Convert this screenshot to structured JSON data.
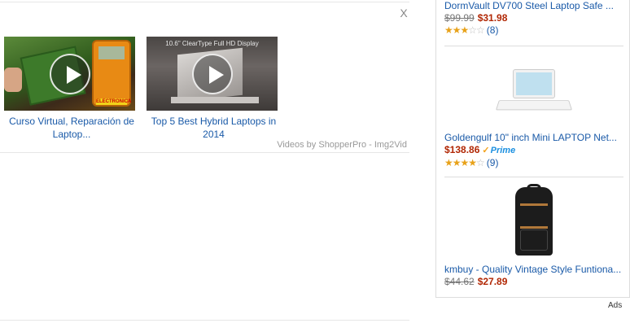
{
  "video_widget": {
    "close_label": "X",
    "videos": [
      {
        "title": "Curso Virtual, Reparación de Laptop...",
        "thumb_caption": "ELECTRONICA"
      },
      {
        "title": "Top 5 Best Hybrid Laptops in 2014",
        "thumb_caption": "10.6\" ClearType Full HD Display"
      }
    ],
    "credit": "Videos by ShopperPro - Img2Vid"
  },
  "ads": {
    "label": "Ads",
    "items": [
      {
        "title": "DormVault DV700 Steel Laptop Safe ...",
        "old_price": "$99.99",
        "price": "$31.98",
        "rating": 3,
        "reviews": "(8)"
      },
      {
        "title": "Goldengulf 10\" inch Mini LAPTOP Net...",
        "price": "$138.86",
        "prime_label": "Prime",
        "rating": 4,
        "reviews": "(9)"
      },
      {
        "title": "kmbuy - Quality Vintage Style Funtiona...",
        "old_price": "$44.62",
        "price": "$27.89"
      }
    ]
  },
  "colors": {
    "link": "#1a5aa8",
    "price": "#b12704",
    "star": "#e8a21a",
    "prime": "#1a8fe0"
  }
}
